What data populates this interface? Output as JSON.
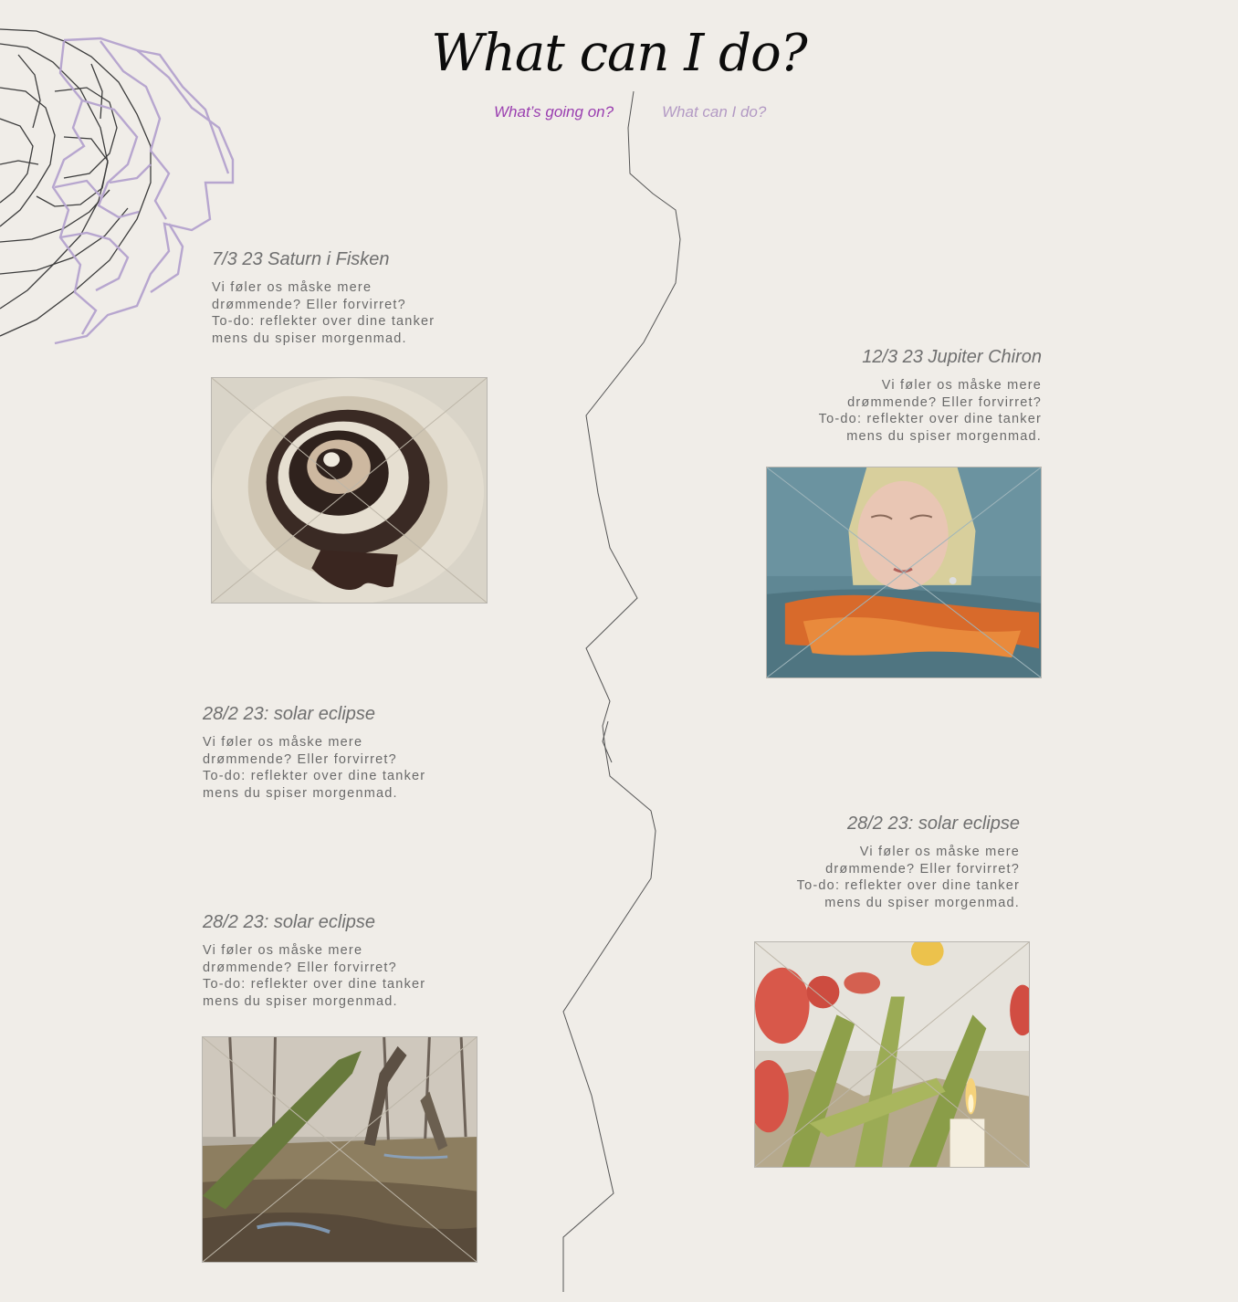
{
  "page": {
    "title": "What can I do?"
  },
  "nav": {
    "items": [
      {
        "label": "What’s going on?",
        "active": true
      },
      {
        "label": "What can I do?",
        "active": false
      }
    ]
  },
  "entries": [
    {
      "title": "7/3 23 Saturn i Fisken",
      "text": "Vi føler os måske mere\ndrømmende? Eller forvirret?\nTo-do: reflekter over dine tanker\nmens du spiser morgenmad.",
      "image": "chocolate-swirl-photo"
    },
    {
      "title": "12/3 23 Jupiter Chiron",
      "text": "Vi føler os måske mere\ndrømmende? Eller forvirret?\nTo-do: reflekter over dine tanker\nmens du spiser morgenmad.",
      "image": "woman-in-water-photo"
    },
    {
      "title": "28/2 23: solar eclipse",
      "text": "Vi føler os måske mere\ndrømmende? Eller forvirret?\nTo-do: reflekter over dine tanker\nmens du spiser morgenmad.",
      "image": null
    },
    {
      "title": "28/2 23: solar eclipse",
      "text": "Vi føler os måske mere\ndrømmende? Eller forvirret?\nTo-do: reflekter over dine tanker\nmens du spiser morgenmad.",
      "image": "tulips-candle-photo"
    },
    {
      "title": "28/2 23: solar eclipse",
      "text": "Vi føler os måske mere\ndrømmende? Eller forvirret?\nTo-do: reflekter over dine tanker\nmens du spiser morgenmad.",
      "image": "forest-tree-photo"
    }
  ],
  "colors": {
    "background": "#f0ede8",
    "nav_active": "#9a3fb0",
    "nav_inactive": "#b39ac4",
    "decoration_purple": "#b7a6cf",
    "decoration_dark": "#3a3a3a"
  }
}
